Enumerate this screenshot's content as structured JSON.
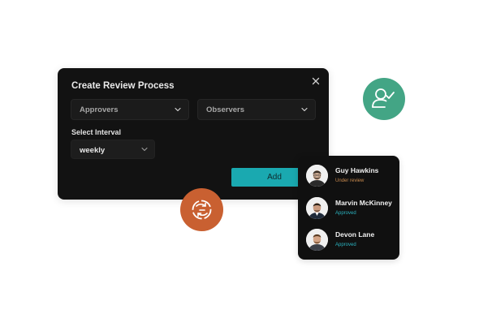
{
  "dialog": {
    "title": "Create Review Process",
    "approvers_label": "Approvers",
    "observers_label": "Observers",
    "interval_label": "Select Interval",
    "interval_value": "weekly",
    "add_label": "Add"
  },
  "reviewers": [
    {
      "name": "Guy Hawkins",
      "status": "Under review"
    },
    {
      "name": "Marvin McKinney",
      "status": "Approved"
    },
    {
      "name": "Devon Lane",
      "status": "Approved"
    }
  ],
  "colors": {
    "dialog_bg": "#121212",
    "accent_teal": "#1aa9b0",
    "user_badge": "#43a585",
    "cycle_badge": "#c96031",
    "status_review": "#c98a4e",
    "status_approved": "#2bb3c0"
  },
  "icons": {
    "close": "close-icon",
    "dropdown": "chevron-down-icon",
    "user_check": "user-check-icon",
    "cycle": "refresh-cycle-icon"
  }
}
